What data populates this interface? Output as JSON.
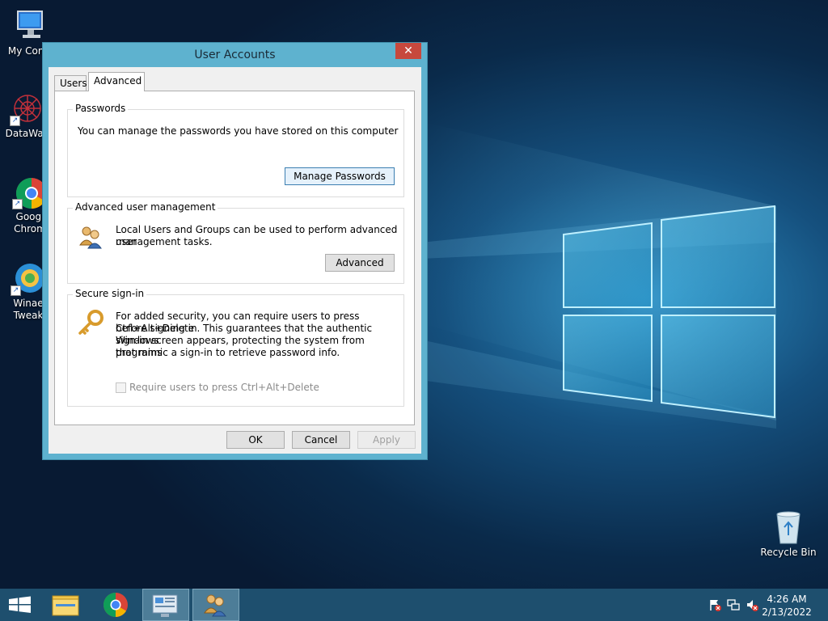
{
  "desktop": {
    "icons": [
      {
        "label": "My Comp",
        "icon": "computer-icon"
      },
      {
        "label": "DataWag",
        "icon": "datawag-icon"
      },
      {
        "label": "Googl\nChrom",
        "line1": "Googl",
        "line2": "Chrom",
        "icon": "chrome-icon"
      },
      {
        "label": "Winae\nTweak",
        "line1": "Winae",
        "line2": "Tweak",
        "icon": "winaero-icon"
      },
      {
        "label": "Recycle Bin",
        "icon": "recycle-bin-icon"
      }
    ]
  },
  "window": {
    "title": "User Accounts",
    "close_glyph": "✕",
    "tabs": [
      {
        "label": "Users",
        "active": false
      },
      {
        "label": "Advanced",
        "active": true
      }
    ],
    "passwords": {
      "title": "Passwords",
      "text": "You can manage the passwords you have stored on this computer",
      "button": "Manage Passwords"
    },
    "advanced_mgmt": {
      "title": "Advanced user management",
      "text_line1": "Local Users and Groups can be used to perform advanced user",
      "text_line2": "management tasks.",
      "button": "Advanced"
    },
    "secure_signin": {
      "title": "Secure sign-in",
      "text_line1": "For added security, you can require users to press Ctrl+Alt+Delete",
      "text_line2": "before signing in. This guarantees that the authentic Windows",
      "text_line3": "sign-in screen appears, protecting the system from programs",
      "text_line4": "that mimic a sign-in to retrieve password info.",
      "checkbox_label": "Require users to press Ctrl+Alt+Delete",
      "checkbox_checked": false
    },
    "buttons": {
      "ok": "OK",
      "cancel": "Cancel",
      "apply": "Apply"
    }
  },
  "taskbar": {
    "items": [
      {
        "icon": "windows-start-icon"
      },
      {
        "icon": "file-explorer-icon"
      },
      {
        "icon": "chrome-icon"
      },
      {
        "icon": "control-panel-icon"
      },
      {
        "icon": "user-accounts-icon",
        "active": true
      }
    ],
    "tray": {
      "time": "4:26 AM",
      "date": "2/13/2022"
    }
  },
  "colors": {
    "window_frame": "#5eb2cf",
    "close_button": "#c7483d",
    "taskbar": "#1e4f6e"
  }
}
